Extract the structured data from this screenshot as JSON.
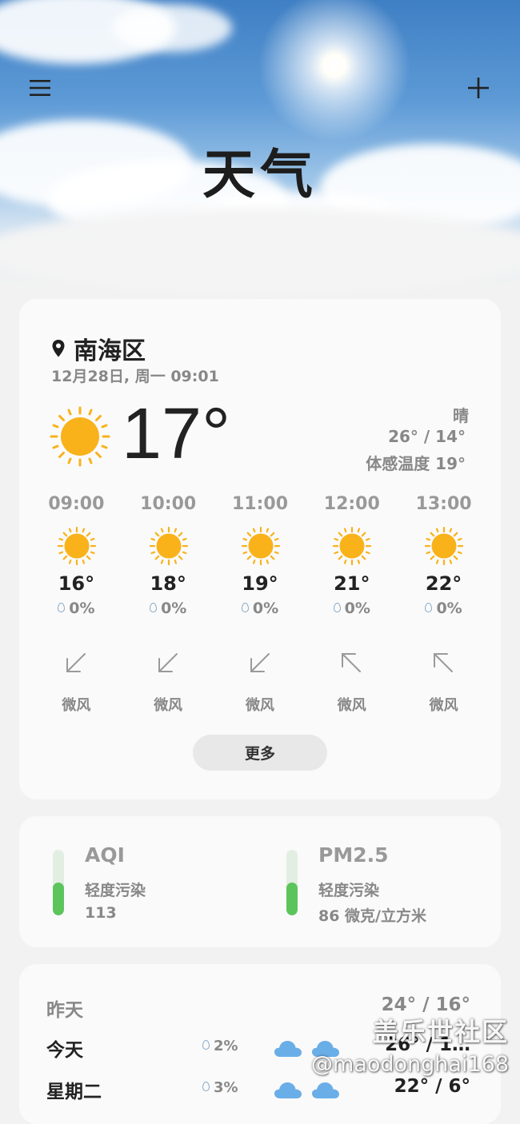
{
  "header": {
    "title": "天气",
    "menu_icon": "hamburger-menu-icon",
    "add_icon": "plus-icon"
  },
  "current": {
    "location": "南海区",
    "datetime": "12月28日, 周一 09:01",
    "temperature": "17°",
    "condition": "晴",
    "high_low": "26° / 14°",
    "feels_like": "体感温度 19°",
    "icon": "sun-icon"
  },
  "hourly": [
    {
      "time": "09:00",
      "temp": "16°",
      "rain": "0%",
      "wind": "微风",
      "wind_dir": "southwest-arrow-icon"
    },
    {
      "time": "10:00",
      "temp": "18°",
      "rain": "0%",
      "wind": "微风",
      "wind_dir": "southwest-arrow-icon"
    },
    {
      "time": "11:00",
      "temp": "19°",
      "rain": "0%",
      "wind": "微风",
      "wind_dir": "southwest-arrow-icon"
    },
    {
      "time": "12:00",
      "temp": "21°",
      "rain": "0%",
      "wind": "微风",
      "wind_dir": "northwest-arrow-icon"
    },
    {
      "time": "13:00",
      "temp": "22°",
      "rain": "0%",
      "wind": "微风",
      "wind_dir": "northwest-arrow-icon"
    }
  ],
  "more_label": "更多",
  "air": [
    {
      "title": "AQI",
      "level": "轻度污染",
      "value": "113",
      "fill_fraction": 0.5
    },
    {
      "title": "PM2.5",
      "level": "轻度污染",
      "value": "86 微克/立方米",
      "fill_fraction": 0.5
    }
  ],
  "daily": [
    {
      "day": "昨天",
      "rain": "",
      "range": "24° / 16°",
      "muted": true
    },
    {
      "day": "今天",
      "rain": "2%",
      "range": "26° / 1…",
      "muted": false
    },
    {
      "day": "星期二",
      "rain": "3%",
      "range": "22° / 6°",
      "muted": false
    }
  ],
  "watermark": {
    "line1": "盖乐世社区",
    "line2": "@maodonghai168"
  },
  "colors": {
    "sun": "#f9b21a",
    "aqi_green": "#5bc45b",
    "cloud_blue": "#6aaee8"
  }
}
